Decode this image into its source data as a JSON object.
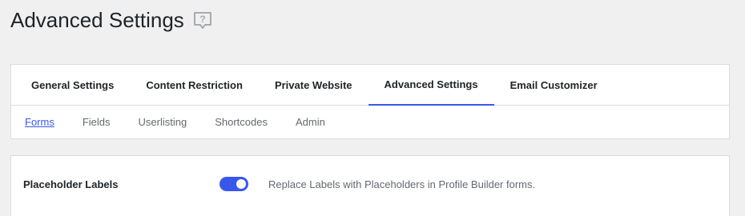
{
  "header": {
    "title": "Advanced Settings",
    "help_icon": "help-speech-bubble-icon"
  },
  "main_tabs": [
    {
      "label": "General Settings",
      "active": false
    },
    {
      "label": "Content Restriction",
      "active": false
    },
    {
      "label": "Private Website",
      "active": false
    },
    {
      "label": "Advanced Settings",
      "active": true
    },
    {
      "label": "Email Customizer",
      "active": false
    }
  ],
  "sub_tabs": [
    {
      "label": "Forms",
      "active": true
    },
    {
      "label": "Fields",
      "active": false
    },
    {
      "label": "Userlisting",
      "active": false
    },
    {
      "label": "Shortcodes",
      "active": false
    },
    {
      "label": "Admin",
      "active": false
    }
  ],
  "settings": [
    {
      "label": "Placeholder Labels",
      "enabled": true,
      "description": "Replace Labels with Placeholders in Profile Builder forms."
    }
  ],
  "colors": {
    "accent": "#3858e9",
    "background": "#f0f0f1",
    "card": "#ffffff",
    "border": "#dcdcde"
  }
}
